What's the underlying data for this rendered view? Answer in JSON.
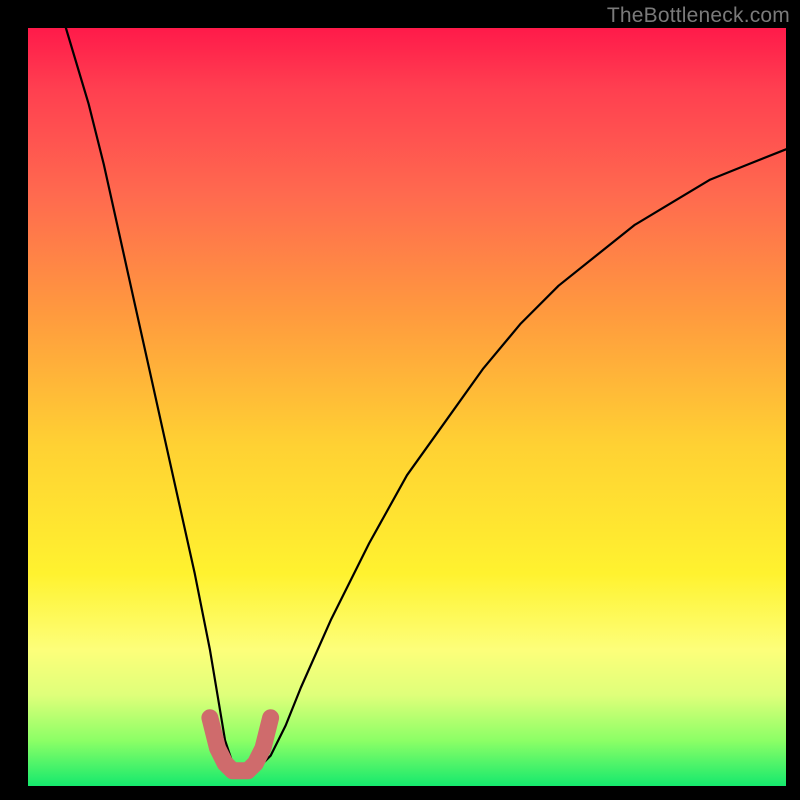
{
  "watermark": "TheBottleneck.com",
  "chart_data": {
    "type": "line",
    "title": "",
    "xlabel": "",
    "ylabel": "",
    "xlim": [
      0,
      100
    ],
    "ylim": [
      0,
      100
    ],
    "series": [
      {
        "name": "bottleneck-curve",
        "x": [
          5,
          8,
          10,
          12,
          14,
          16,
          18,
          20,
          22,
          24,
          25,
          26,
          27,
          28,
          30,
          32,
          34,
          36,
          40,
          45,
          50,
          55,
          60,
          65,
          70,
          75,
          80,
          85,
          90,
          95,
          100
        ],
        "y": [
          100,
          90,
          82,
          73,
          64,
          55,
          46,
          37,
          28,
          18,
          12,
          6,
          3,
          2,
          2,
          4,
          8,
          13,
          22,
          32,
          41,
          48,
          55,
          61,
          66,
          70,
          74,
          77,
          80,
          82,
          84
        ]
      },
      {
        "name": "optimal-zone",
        "x": [
          24,
          25,
          26,
          27,
          28,
          29,
          30,
          31,
          32
        ],
        "y": [
          9,
          5,
          3,
          2,
          2,
          2,
          3,
          5,
          9
        ]
      }
    ],
    "gradient_stops": [
      {
        "pct": 0,
        "color": "#ff1a4a"
      },
      {
        "pct": 22,
        "color": "#ff6a4f"
      },
      {
        "pct": 55,
        "color": "#ffd133"
      },
      {
        "pct": 82,
        "color": "#fdff7a"
      },
      {
        "pct": 100,
        "color": "#15e96d"
      }
    ]
  }
}
